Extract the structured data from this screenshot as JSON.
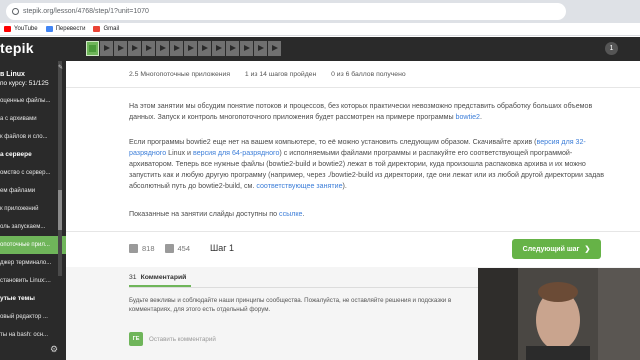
{
  "browser": {
    "url": "stepik.org/lesson/4768/step/1?unit=1070",
    "bookmarks": [
      {
        "label": "YouTube",
        "color": "#ff0000"
      },
      {
        "label": "Перевести",
        "color": "#4285f4"
      },
      {
        "label": "Gmail",
        "color": "#ea4335"
      }
    ]
  },
  "topbar": {
    "logo": "tepik",
    "notification_count": "1",
    "steps_total": 14,
    "current_step": 1
  },
  "sidebar": {
    "course_title": "в Linux",
    "progress": "по курсу: 51/125",
    "items": [
      {
        "label": "оценные файлы...",
        "type": "item"
      },
      {
        "label": "а с архивами",
        "type": "item"
      },
      {
        "label": "к файлов и сло...",
        "type": "item"
      },
      {
        "label": "а сервере",
        "type": "section"
      },
      {
        "label": "омство с сервер...",
        "type": "item"
      },
      {
        "label": "ем файлами",
        "type": "item"
      },
      {
        "label": "к приложений",
        "type": "item"
      },
      {
        "label": "оль запускаем...",
        "type": "item"
      },
      {
        "label": "опоточные прил...",
        "type": "active"
      },
      {
        "label": "джер терминало...",
        "type": "item"
      },
      {
        "label": "становить Linux:...",
        "type": "item"
      },
      {
        "label": "утые темы",
        "type": "section"
      },
      {
        "label": "овый редактор ...",
        "type": "item"
      },
      {
        "label": "ты на bash: осн...",
        "type": "item"
      }
    ]
  },
  "lesson": {
    "breadcrumb": "2.5 Многопоточные приложения",
    "step_status": "1 из 14 шагов пройден",
    "score": "0 из 6 баллов  получено",
    "para1": "На этом занятии мы обсудим понятие потоков и процессов, без которых практически невозможно представить обработку больших объемов данных. Запуск и контроль многопоточного приложения будет рассмотрен на примере программы ",
    "para1_link": "bowtie2",
    "para1_end": ".",
    "para2_a": "Если программы bowtie2 еще нет на вашем компьютере, то её можно установить следующим образом. Скачивайте архив (",
    "para2_link1": "версия для 32-разрядного",
    "para2_b": " Linux и ",
    "para2_link2": "версия для 64-разрядного",
    "para2_c": ") с исполняемыми файлами программы и распакуйте его соответствующей программой-архиватором. Теперь все нужные файлы (bowtie2-build и bowtie2) лежат в той директории, куда произошла распаковка архива и их можно запустить как и любую другую программу (например, через ./bowtie2-build из директории, где они лежат или из любой другой директории задав абсолютный путь до bowtie2-build, см. ",
    "para2_link3": "соответствующее занятие",
    "para2_d": ").",
    "para3": "Показанные на занятии слайды доступны по ",
    "para3_link": "ссылке",
    "para3_end": ".",
    "likes": "818",
    "dislikes": "454",
    "step_label": "Шаг 1",
    "next_button": "Следующий шаг",
    "comments_count": "31",
    "comments_tab": "Комментарий",
    "comment_rules": "Будьте вежливы и соблюдайте наши принципы сообщества. Пожалуйста, не оставляйте решения и подсказки в комментариях, для этого есть отдельный форум.",
    "avatar_initials": "ГЕ",
    "leave_comment": "Оставить комментарий"
  },
  "colors": {
    "accent_green": "#66b347",
    "dark_bg": "#2a2a2a",
    "link_blue": "#3b7dd8"
  }
}
